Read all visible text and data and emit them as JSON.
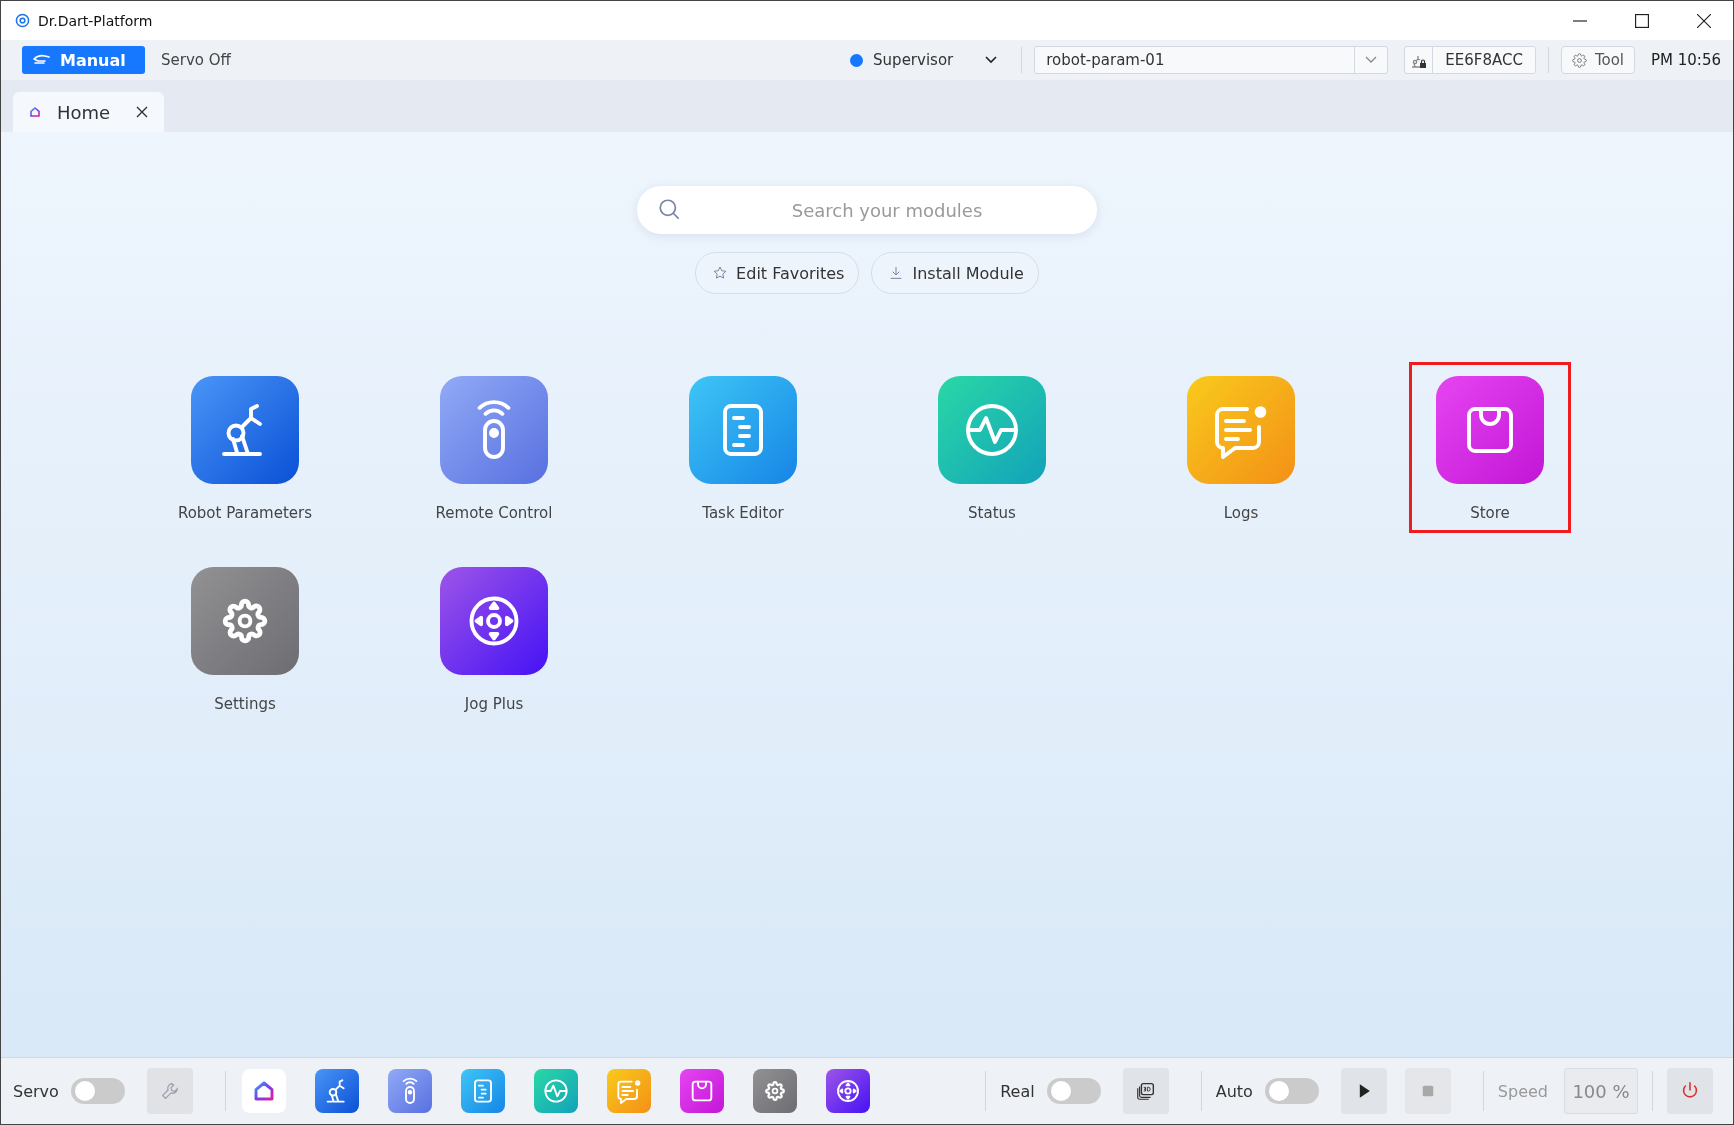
{
  "window": {
    "title": "Dr.Dart-Platform"
  },
  "toolbar": {
    "mode_button": "Manual",
    "servo_status": "Servo Off",
    "user": {
      "label": "Supervisor",
      "color": "#1677ff"
    },
    "robot_param": {
      "value": "robot-param-01"
    },
    "device_id": "EE6F8ACC",
    "tool_button": "Tool",
    "time": "PM 10:56"
  },
  "tabs": [
    {
      "label": "Home",
      "selected": true
    }
  ],
  "search": {
    "placeholder": "Search your modules"
  },
  "actions": [
    {
      "kind": "favorites",
      "label": "Edit Favorites"
    },
    {
      "kind": "install",
      "label": "Install Module"
    }
  ],
  "modules": [
    {
      "kind": "robot",
      "label": "Robot Parameters",
      "highlighted": false
    },
    {
      "kind": "remote",
      "label": "Remote Control",
      "highlighted": false
    },
    {
      "kind": "task",
      "label": "Task Editor",
      "highlighted": false
    },
    {
      "kind": "status",
      "label": "Status",
      "highlighted": false
    },
    {
      "kind": "logs",
      "label": "Logs",
      "highlighted": false
    },
    {
      "kind": "store",
      "label": "Store",
      "highlighted": true
    },
    {
      "kind": "settings",
      "label": "Settings",
      "highlighted": false
    },
    {
      "kind": "jog",
      "label": "Jog Plus",
      "highlighted": false
    }
  ],
  "bottom_bar": {
    "servo": {
      "label": "Servo",
      "on": false
    },
    "dock": [
      {
        "kind": "home"
      },
      {
        "kind": "robot"
      },
      {
        "kind": "remote"
      },
      {
        "kind": "task"
      },
      {
        "kind": "status"
      },
      {
        "kind": "logs"
      },
      {
        "kind": "store"
      },
      {
        "kind": "settings"
      },
      {
        "kind": "jog"
      }
    ],
    "real": {
      "label": "Real",
      "on": false
    },
    "auto": {
      "label": "Auto",
      "on": false
    },
    "stop": {
      "disabled": true
    },
    "speed": {
      "label": "Speed",
      "value": "100 %",
      "disabled": true
    }
  }
}
